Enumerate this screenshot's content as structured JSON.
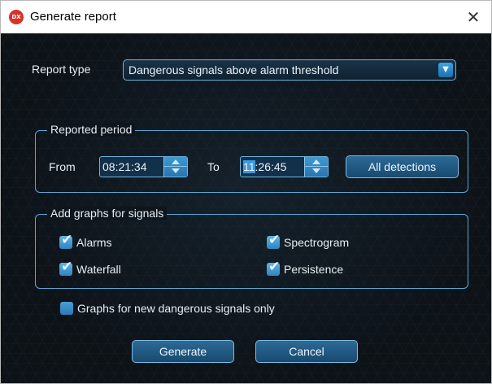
{
  "window": {
    "title": "Generate report",
    "app_icon_text": "DX",
    "close_glyph": "✕"
  },
  "report_type": {
    "label": "Report type",
    "value": "Dangerous signals above alarm threshold",
    "arrow": "▼"
  },
  "period": {
    "title": "Reported period",
    "from_label": "From",
    "from_value": "08:21:34",
    "to_label": "To",
    "to_value_selected": "11",
    "to_value_rest": ":26:45",
    "all_button": "All detections"
  },
  "graphs": {
    "title": "Add graphs for signals",
    "items": [
      {
        "label": "Alarms",
        "checked": true
      },
      {
        "label": "Waterfall",
        "checked": true
      },
      {
        "label": "Spectrogram",
        "checked": true
      },
      {
        "label": "Persistence",
        "checked": true
      }
    ]
  },
  "new_only": {
    "label": "Graphs for new dangerous signals only",
    "checked": false
  },
  "actions": {
    "generate": "Generate",
    "cancel": "Cancel"
  },
  "icons": {
    "check": "✔"
  },
  "colors": {
    "accent": "#3d9fe0",
    "background": "#0d1217",
    "border": "#5aa7d4"
  }
}
